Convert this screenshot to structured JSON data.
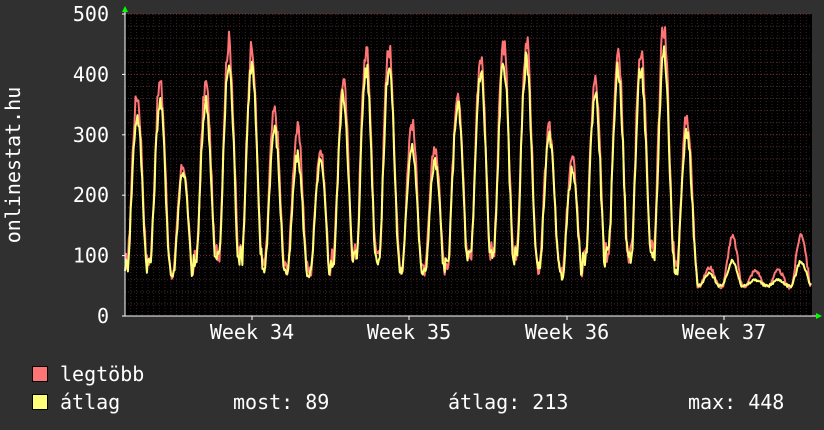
{
  "chart_data": {
    "type": "line",
    "ylabel": "onlinestat.hu",
    "ylim": [
      0,
      500
    ],
    "yticks": [
      0,
      100,
      200,
      300,
      400,
      500
    ],
    "xticks": [
      "Week 34",
      "Week 35",
      "Week 36",
      "Week 37"
    ],
    "grid": true,
    "days": 30,
    "series": [
      {
        "name": "legtöbb",
        "color": "#ff7575",
        "daily_peaks": [
          365,
          385,
          250,
          385,
          455,
          440,
          340,
          310,
          275,
          390,
          440,
          445,
          320,
          280,
          375,
          430,
          450,
          455,
          310,
          260,
          390,
          445,
          445,
          480,
          330,
          80,
          130,
          75,
          75,
          135
        ]
      },
      {
        "name": "átlag",
        "color": "#ffff7a",
        "daily_peaks": [
          330,
          355,
          240,
          355,
          415,
          415,
          310,
          265,
          255,
          365,
          410,
          415,
          285,
          255,
          350,
          405,
          420,
          425,
          295,
          240,
          370,
          410,
          410,
          440,
          305,
          70,
          90,
          60,
          60,
          90
        ]
      }
    ]
  },
  "legend": [
    {
      "label": "legtöbb",
      "color": "#ff7575"
    },
    {
      "label": "átlag",
      "color": "#ffff7a"
    }
  ],
  "stats": {
    "most": "most: 89",
    "atlag": "átlag: 213",
    "max": "max: 448"
  }
}
